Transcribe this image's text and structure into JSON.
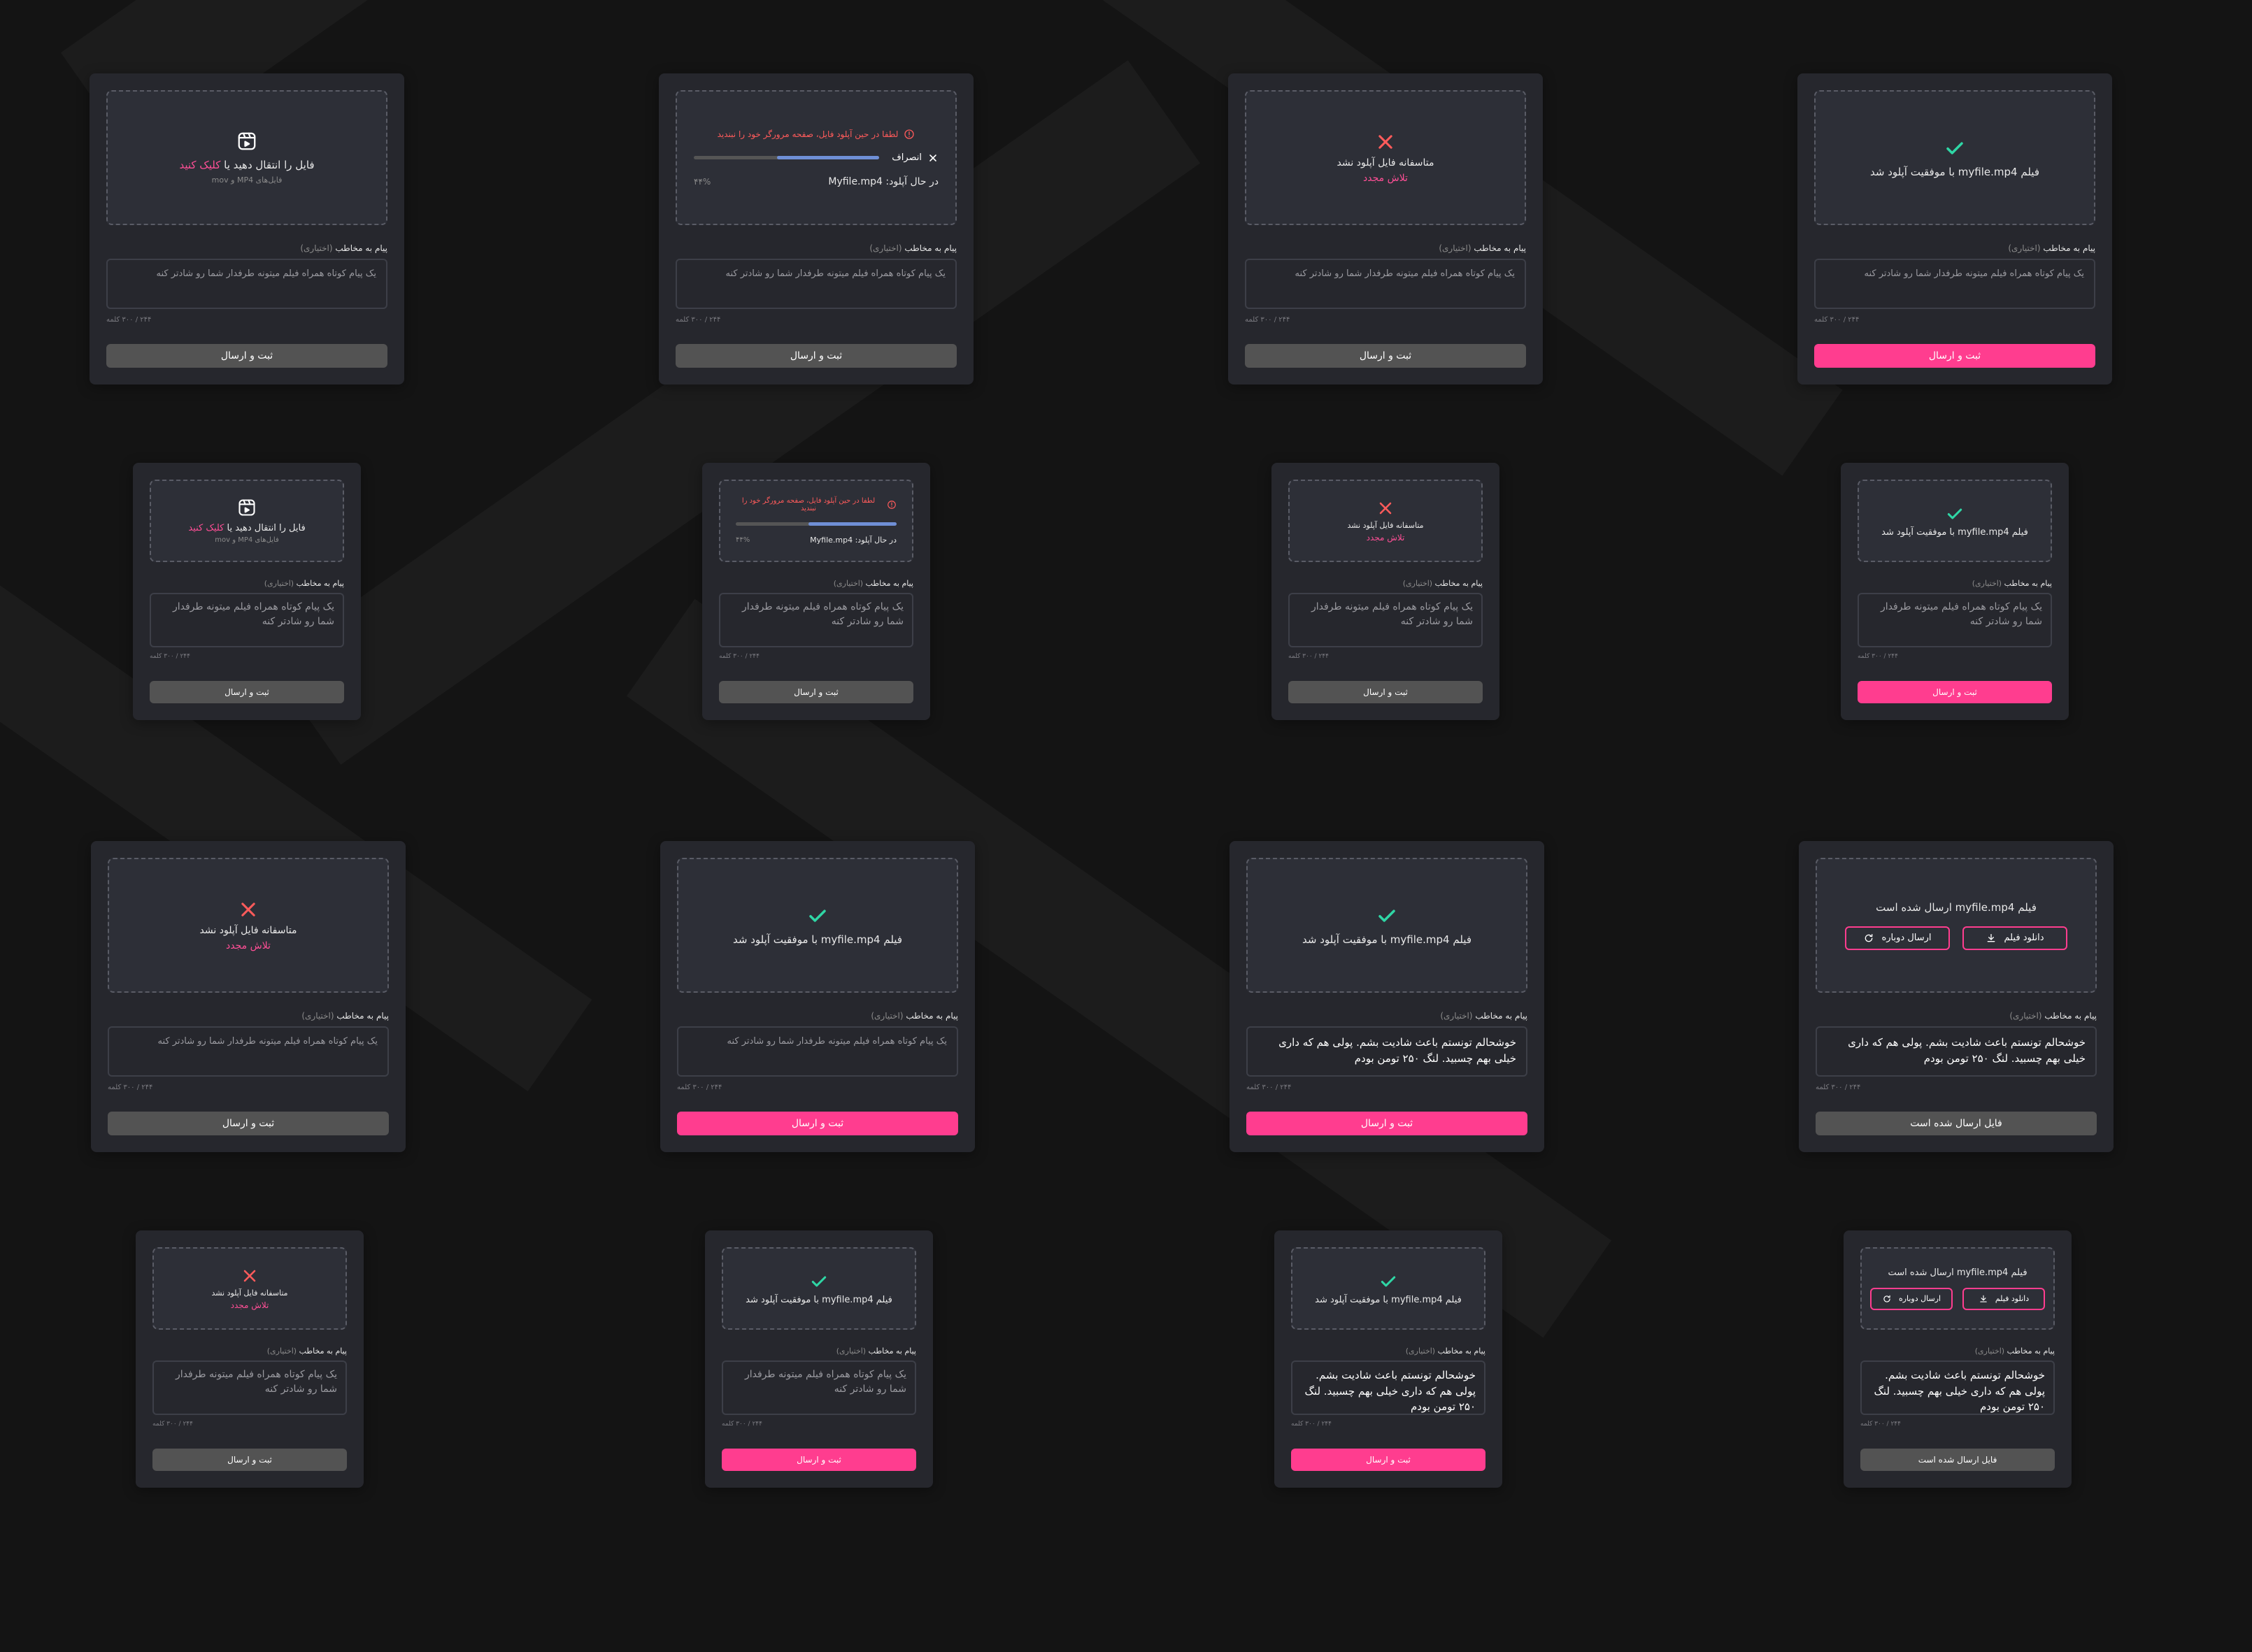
{
  "upload": {
    "prompt_prefix": "فایل را انتقال دهید یا",
    "prompt_link": "کلیک کنید",
    "formats": "فایل‌های MP4 و mov"
  },
  "uploading": {
    "warning": "لطفا در حین آپلود فایل، صفحه مرورگر خود را نبندید",
    "cancel": "انصراف",
    "status": "در حال آپلود: Myfile.mp4",
    "percent": "۴۴%",
    "progress": 0.55
  },
  "error": {
    "message": "متاسفانه فایل آپلود نشد",
    "retry": "تلاش مجدد"
  },
  "success": {
    "message": "فیلم myfile.mp4 با موفقیت آپلود شد"
  },
  "sent": {
    "message": "فیلم myfile.mp4 ارسال شده است",
    "download": "دانلود فیلم",
    "resend": "ارسال دوباره",
    "button": "فایل ارسال شده است"
  },
  "message": {
    "label": "پیام به مخاطب",
    "optional": "(اختیاری)",
    "placeholder": "یک پیام کوتاه همراه فیلم میتونه طرفدار شما رو شادتر کنه",
    "filled_text": "خوشحالم تونستم باعث شادیت بشم. پولی هم که داری خیلی بهم چسبید. لنگ ۲۵۰ تومن بودم",
    "counter": "۲۴۴ / ۳۰۰ کلمه"
  },
  "submit_label": "ثبت و ارسال",
  "colors": {
    "accent": "#ff3d8f",
    "error": "#ff5b5b",
    "success": "#2fd6a5",
    "progress": "#6f8fd6",
    "card": "#26272d",
    "disabled": "#535353"
  }
}
